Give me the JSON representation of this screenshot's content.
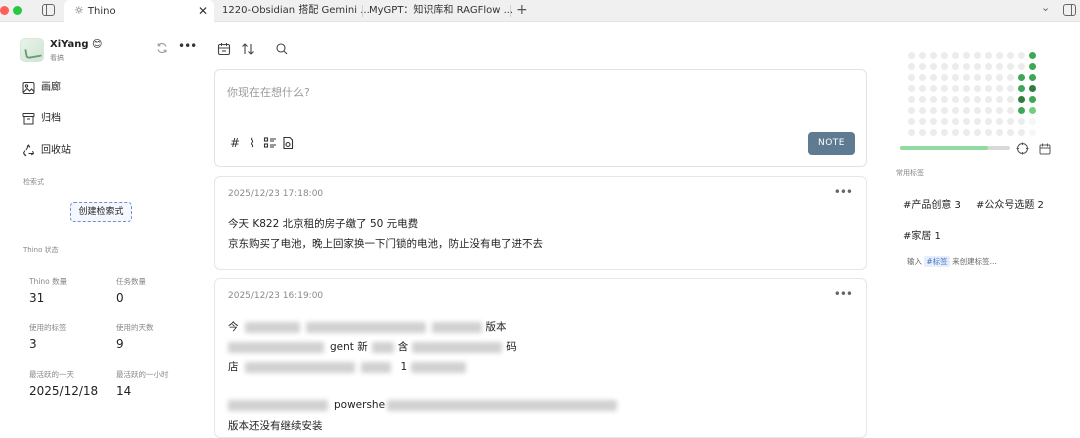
{
  "tabs": {
    "active": {
      "label": "Thino"
    },
    "others": [
      {
        "label": "1220-Obsidian 搭配 Gemini ..."
      },
      {
        "label": "MyGPT：知识库和 RAGFlow ..."
      }
    ]
  },
  "user": {
    "name": "XiYang 😊",
    "subtitle": "看搞"
  },
  "nav": [
    {
      "label": "画廊",
      "icon": "image-icon"
    },
    {
      "label": "归档",
      "icon": "archive-icon"
    },
    {
      "label": "回收站",
      "icon": "recycle-icon"
    }
  ],
  "search_section": {
    "label": "检索式",
    "create_button": "创建检索式"
  },
  "status_section": {
    "label": "Thino 状态",
    "stats": [
      {
        "label": "Thino 数量",
        "value": "31"
      },
      {
        "label": "任务数量",
        "value": "0"
      },
      {
        "label": "使用的标签",
        "value": "3"
      },
      {
        "label": "使用的天数",
        "value": "9"
      },
      {
        "label": "最活跃的一天",
        "value": "2025/12/18"
      },
      {
        "label": "最活跃的一小时",
        "value": "14"
      }
    ]
  },
  "editor": {
    "placeholder": "你现在在想什么?",
    "submit_label": "NOTE"
  },
  "memos": [
    {
      "time": "2025/12/23 17:18:00",
      "lines": [
        "今天 K822 北京租的房子缴了 50 元电费",
        "京东购买了电池，晚上回家换一下门锁的电池，防止没有电了进不去"
      ]
    },
    {
      "time": "2025/12/23 16:19:00",
      "fragments": {
        "l1a": "今",
        "l1b": "版本",
        "l2a": "gent 新",
        "l2b": "含",
        "l2c": "码",
        "l3a": "店",
        "l3b": "1",
        "l4a": "powershe",
        "l5": "版本还没有继续安装"
      }
    }
  ],
  "right": {
    "progress": 0.8,
    "tags_label": "常用标签",
    "tags": [
      "#产品创意 3",
      "#公众号选题 2",
      "#家居 1"
    ],
    "hint_prefix": "输入",
    "hint_tag": "#标签",
    "hint_suffix": "来创建标签..."
  },
  "colors": {
    "accent_note_button": "#5e7b92",
    "heat_dark": "#2f7d3e",
    "heat_mid": "#3fa656",
    "heat_light": "#6fd07f",
    "heat_empty": "#ececec"
  }
}
